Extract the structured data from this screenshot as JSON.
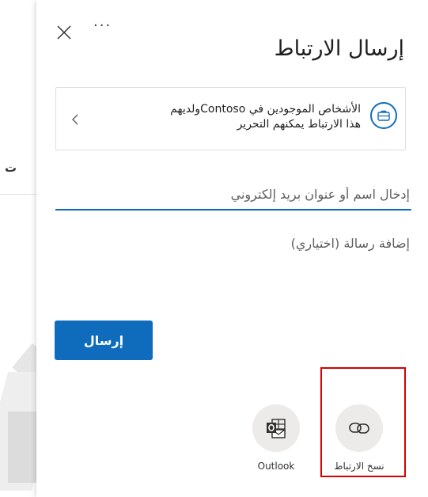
{
  "background": {
    "partial_text": "ت"
  },
  "dialog": {
    "title": "إرسال الارتباط",
    "more_label": "···",
    "permission": {
      "line1": "الأشخاص الموجودين في Contosoولديهم",
      "line2": "هذا الارتباط يمكنهم التحرير"
    },
    "recipient_placeholder": "إدخال اسم أو عنوان بريد إلكتروني",
    "message_placeholder": "إضافة رسالة (اختياري)",
    "send_label": "إرسال",
    "share_options": [
      {
        "label": "نسخ الارتباط",
        "icon": "link-icon"
      },
      {
        "label": "Outlook",
        "icon": "outlook-icon"
      }
    ],
    "colors": {
      "accent": "#0f6cbd",
      "highlight": "#d80000"
    }
  }
}
